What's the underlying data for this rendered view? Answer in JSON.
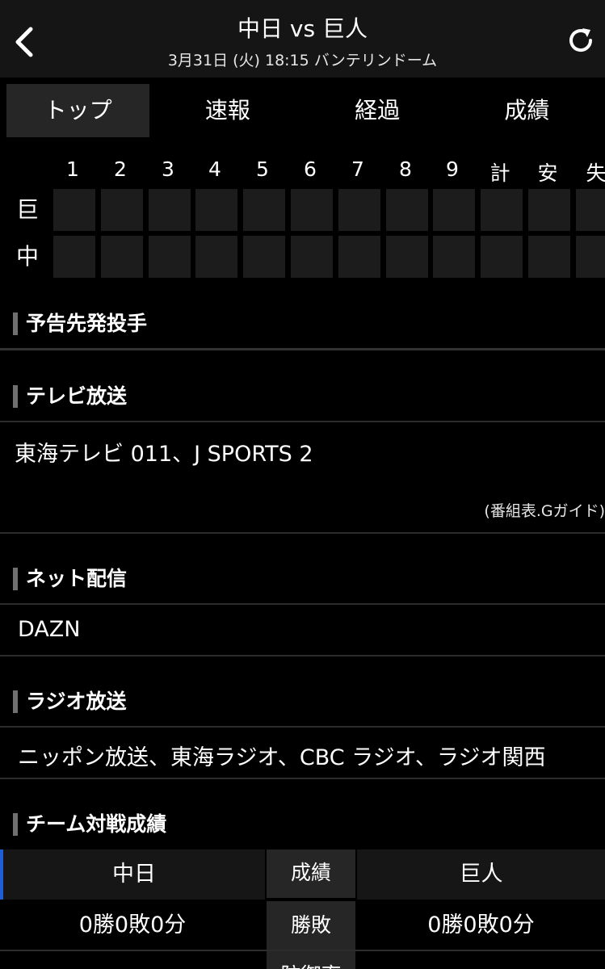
{
  "header": {
    "title": "中日 vs 巨人",
    "subtitle": "3月31日 (火) 18:15 バンテリンドーム"
  },
  "tabs": [
    "トップ",
    "速報",
    "経過",
    "成績"
  ],
  "scoreboard": {
    "columns": [
      "1",
      "2",
      "3",
      "4",
      "5",
      "6",
      "7",
      "8",
      "9",
      "計",
      "安",
      "失"
    ],
    "teams": [
      "巨",
      "中"
    ]
  },
  "sections": {
    "starting_pitchers": {
      "title": "予告先発投手"
    },
    "tv": {
      "title": "テレビ放送",
      "text": "東海テレビ 011、J SPORTS 2",
      "note": "(番組表.Gガイド)"
    },
    "net": {
      "title": "ネット配信",
      "text": "DAZN"
    },
    "radio": {
      "title": "ラジオ放送",
      "text": "ニッポン放送、東海ラジオ、CBC ラジオ、ラジオ関西"
    },
    "record": {
      "title": "チーム対戦成績",
      "team_left": "中日",
      "center_header": "成績",
      "team_right": "巨人",
      "rows": [
        {
          "label": "勝敗",
          "left": "0勝0敗0分",
          "right": "0勝0敗0分"
        },
        {
          "label": "防御率",
          "left": "",
          "right": ""
        }
      ]
    }
  },
  "colors": {
    "background": "#000000",
    "header": "#151515",
    "active_tab": "#262626",
    "accent": "#1e5fd6"
  }
}
